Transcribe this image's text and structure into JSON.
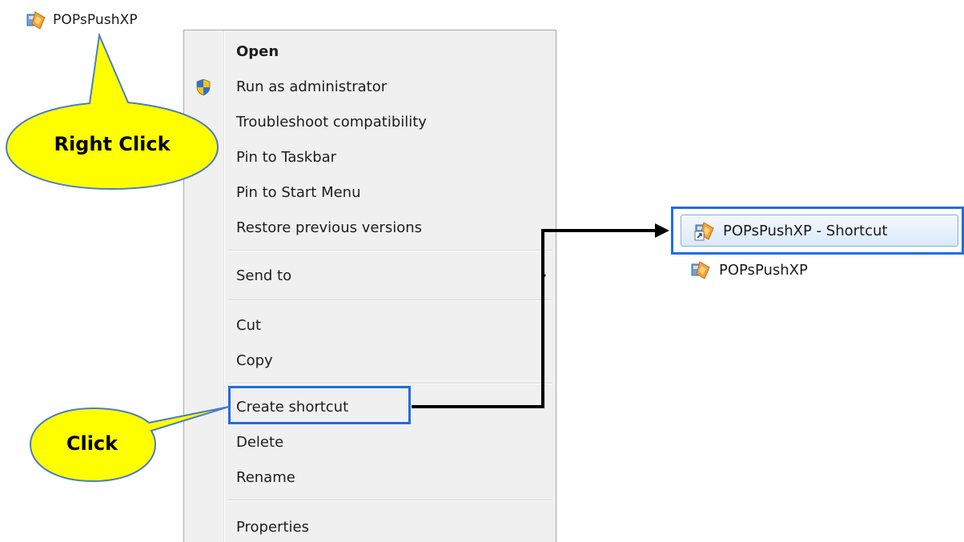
{
  "source_file": {
    "name": "POPsPushXP",
    "icon": "application-icon"
  },
  "context_menu": {
    "items": [
      {
        "label": "Open",
        "bold": true
      },
      {
        "label": "Run as administrator",
        "icon": "uac-shield-icon"
      },
      {
        "label": "Troubleshoot compatibility"
      },
      {
        "label": "Pin to Taskbar"
      },
      {
        "label": "Pin to Start Menu"
      },
      {
        "label": "Restore previous versions"
      },
      {
        "label": "Send to",
        "submenu": true
      },
      {
        "label": "Cut"
      },
      {
        "label": "Copy"
      },
      {
        "label": "Create shortcut",
        "highlighted": true
      },
      {
        "label": "Delete"
      },
      {
        "label": "Rename"
      },
      {
        "label": "Properties"
      }
    ]
  },
  "result": {
    "shortcut_label": "POPsPushXP - Shortcut",
    "original_label": "POPsPushXP"
  },
  "callouts": {
    "right_click": "Right Click",
    "click": "Click"
  },
  "colors": {
    "callout_fill": "#ffff00",
    "callout_stroke": "#4a7cc8",
    "highlight_border": "#1f6fe0",
    "menu_bg": "#f0f0f0",
    "arrow": "#000000"
  }
}
